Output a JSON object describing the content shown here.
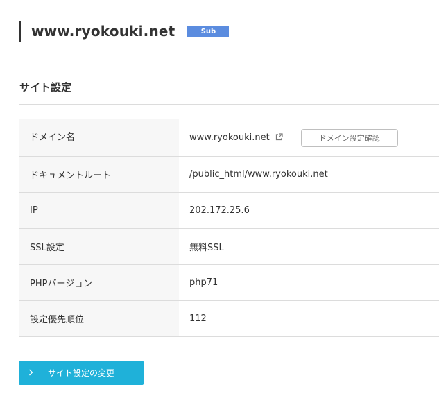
{
  "header": {
    "title": "www.ryokouki.net",
    "badge": "Sub"
  },
  "section": {
    "title": "サイト設定"
  },
  "table": {
    "rows": [
      {
        "label": "ドメイン名",
        "value": "www.ryokouki.net",
        "button": "ドメイン設定確認"
      },
      {
        "label": "ドキュメントルート",
        "value": "/public_html/www.ryokouki.net"
      },
      {
        "label": "IP",
        "value": "202.172.25.6"
      },
      {
        "label": "SSL設定",
        "value": "無料SSL"
      },
      {
        "label": "PHPバージョン",
        "value": "php71"
      },
      {
        "label": "設定優先順位",
        "value": "112"
      }
    ]
  },
  "actions": {
    "change_button": "サイト設定の変更"
  },
  "icons": {
    "external_link": "external-link-icon",
    "chevron": "chevron-right-icon"
  },
  "colors": {
    "badge": "#5b8cdf",
    "primary_button": "#1fb1d9"
  }
}
